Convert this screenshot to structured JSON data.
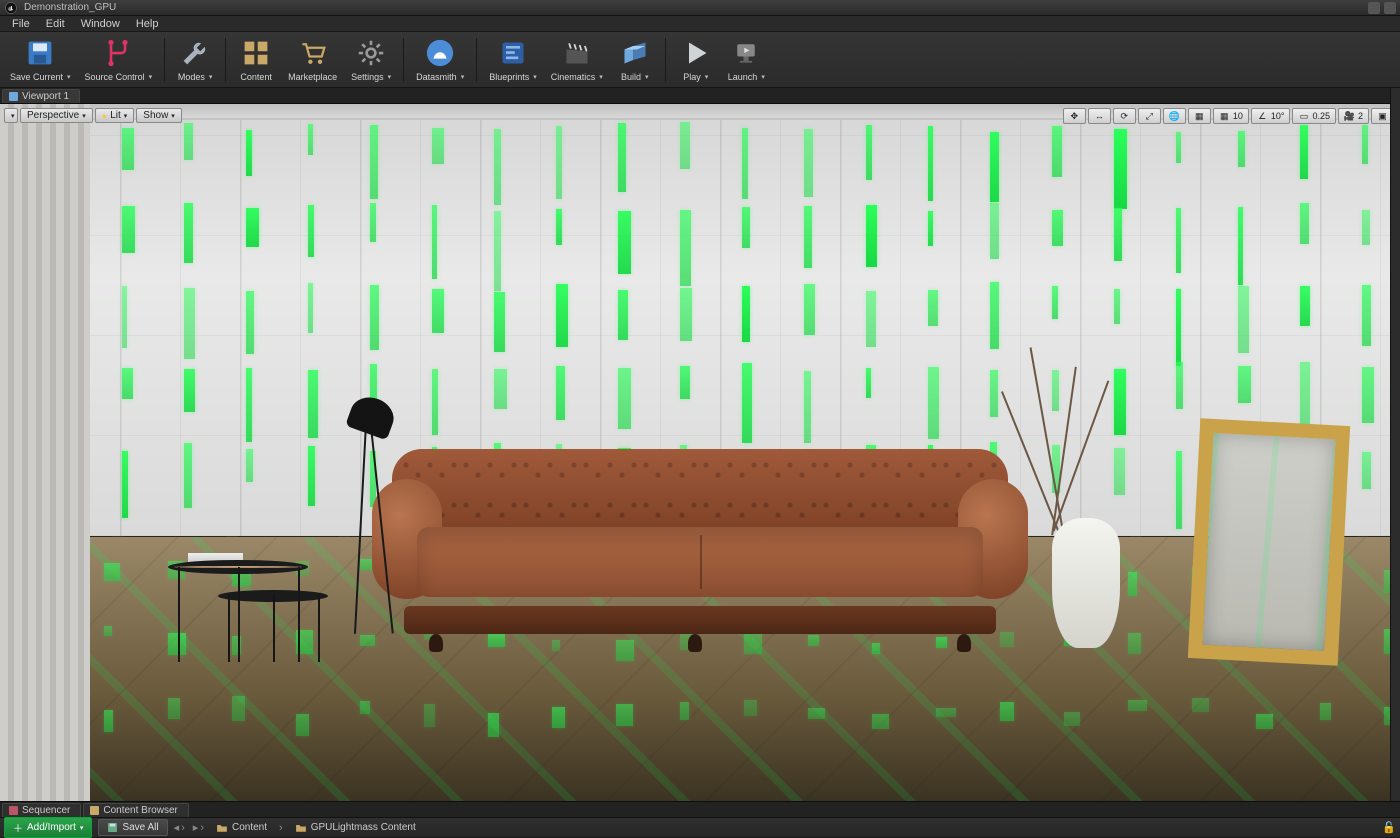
{
  "title": "Demonstration_GPU",
  "menu": {
    "file": "File",
    "edit": "Edit",
    "window": "Window",
    "help": "Help"
  },
  "toolbar": {
    "save": "Save Current",
    "source": "Source Control",
    "modes": "Modes",
    "content": "Content",
    "marketplace": "Marketplace",
    "settings": "Settings",
    "datasmith": "Datasmith",
    "blueprints": "Blueprints",
    "cinematics": "Cinematics",
    "build": "Build",
    "play": "Play",
    "launch": "Launch"
  },
  "tabs": {
    "viewport": "Viewport 1"
  },
  "viewport": {
    "perspective": "Perspective",
    "lit": "Lit",
    "show": "Show",
    "snap1": "10",
    "angle": "10°",
    "scale": "0.25",
    "cam": "2"
  },
  "bottomTabs": {
    "sequencer": "Sequencer",
    "contentBrowser": "Content Browser"
  },
  "footer": {
    "add": "Add/Import",
    "saveall": "Save All",
    "crumbContent": "Content",
    "crumbFolder": "GPULightmass Content"
  }
}
